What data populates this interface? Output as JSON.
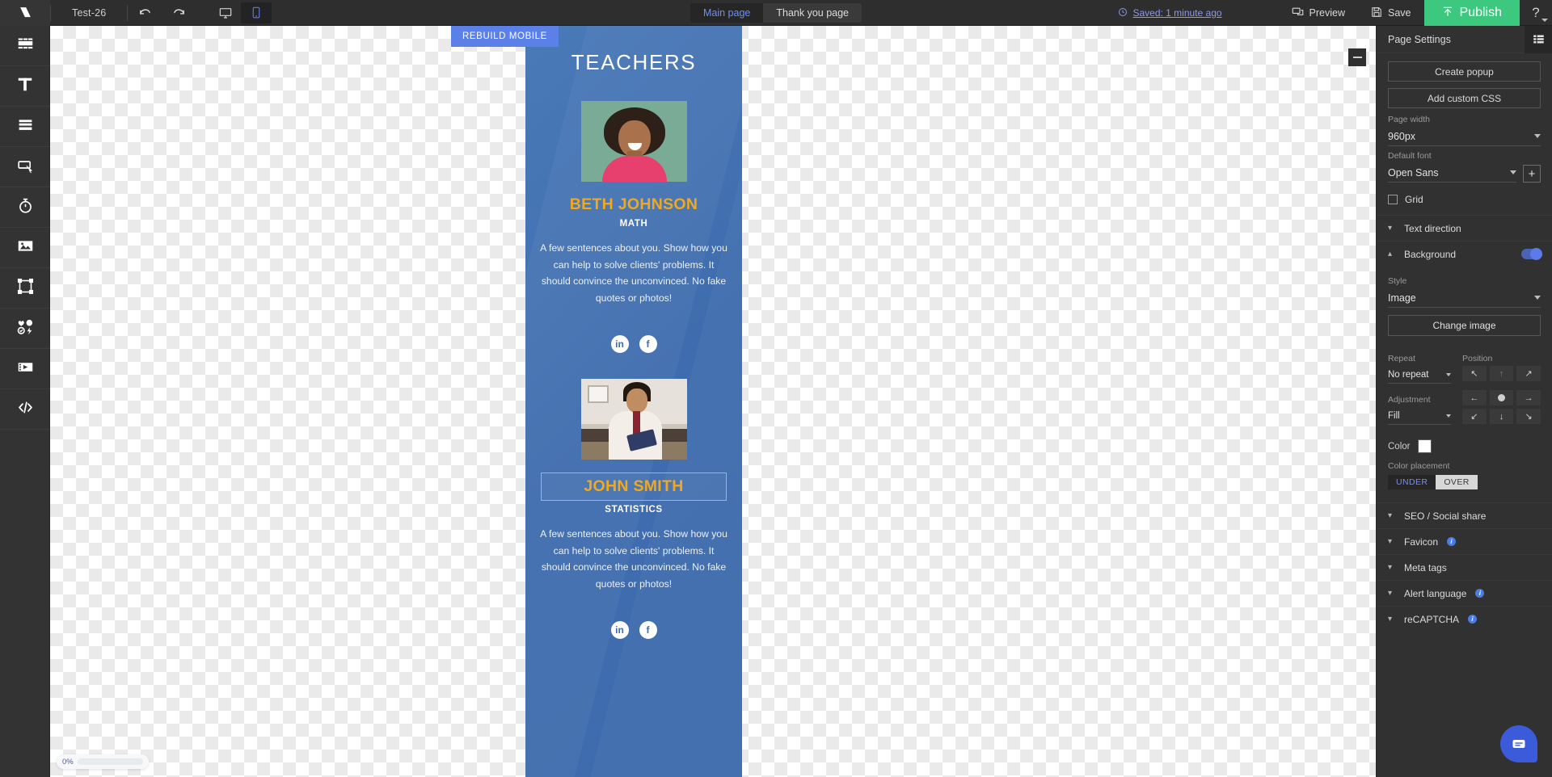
{
  "topbar": {
    "logo_icon": "brand-logo-icon",
    "project_name": "Test-26",
    "undo_icon": "undo-icon",
    "redo_icon": "redo-icon",
    "desktop_icon": "desktop-view-icon",
    "mobile_icon": "mobile-view-icon",
    "tabs": [
      {
        "label": "Main page",
        "active": true
      },
      {
        "label": "Thank you page",
        "active": false
      }
    ],
    "saved_status": "Saved: 1 minute ago",
    "clock_icon": "clock-icon",
    "preview_label": "Preview",
    "preview_icon": "preview-monitor-icon",
    "save_label": "Save",
    "save_icon": "floppy-disk-icon",
    "publish_label": "Publish",
    "publish_icon": "upload-arrow-icon",
    "help_label": "?"
  },
  "sidebar": {
    "items": [
      {
        "name": "blocks",
        "icon": "blocks-icon"
      },
      {
        "name": "text",
        "icon": "text-t-icon"
      },
      {
        "name": "forms",
        "icon": "form-rows-icon"
      },
      {
        "name": "button",
        "icon": "button-cursor-icon"
      },
      {
        "name": "timer",
        "icon": "timer-icon"
      },
      {
        "name": "image",
        "icon": "image-icon"
      },
      {
        "name": "shape",
        "icon": "shape-frame-icon"
      },
      {
        "name": "icons",
        "icon": "icons-collection-icon"
      },
      {
        "name": "video",
        "icon": "video-film-icon"
      },
      {
        "name": "code",
        "icon": "code-brackets-icon"
      }
    ]
  },
  "canvas": {
    "rebuild_label": "REBUILD MOBILE",
    "collapse_icon": "minus-collapse-icon",
    "progress_percent": "0%"
  },
  "mobile_page": {
    "heading": "TEACHERS",
    "teachers": [
      {
        "photo": "portrait-woman-laughing",
        "name": "BETH JOHNSON",
        "role": "MATH",
        "description": "A few sentences about you. Show how you can help to solve clients' problems. It should convince the unconvinced. No fake quotes or photos!",
        "selected": false,
        "social": [
          {
            "icon": "linkedin-icon",
            "glyph": "in"
          },
          {
            "icon": "facebook-icon",
            "glyph": "f"
          }
        ]
      },
      {
        "photo": "portrait-man-tablet",
        "name": "JOHN SMITH",
        "role": "STATISTICS",
        "description": "A few sentences about you. Show how you can help to solve clients' problems. It should convince the unconvinced. No fake quotes or photos!",
        "selected": true,
        "social": [
          {
            "icon": "linkedin-icon",
            "glyph": "in"
          },
          {
            "icon": "facebook-icon",
            "glyph": "f"
          }
        ]
      }
    ]
  },
  "right_panel": {
    "title": "Page Settings",
    "list_icon": "list-layers-icon",
    "create_popup_label": "Create popup",
    "add_custom_css_label": "Add custom CSS",
    "page_width_label": "Page width",
    "page_width_value": "960px",
    "default_font_label": "Default font",
    "default_font_value": "Open Sans",
    "add_font_label": "+",
    "grid_label": "Grid",
    "grid_checked": false,
    "text_direction_label": "Text direction",
    "background_label": "Background",
    "background_enabled": true,
    "style_label": "Style",
    "style_value": "Image",
    "change_image_label": "Change image",
    "repeat_label": "Repeat",
    "repeat_value": "No repeat",
    "position_label": "Position",
    "position_buttons": [
      {
        "icon": "arrow-up-left-icon",
        "glyph": "↖",
        "active": false
      },
      {
        "icon": "arrow-up-icon",
        "glyph": "↑",
        "active": true
      },
      {
        "icon": "arrow-up-right-icon",
        "glyph": "↗",
        "active": false
      },
      {
        "icon": "arrow-left-icon",
        "glyph": "←",
        "active": false
      },
      {
        "icon": "center-dot-icon",
        "glyph": "",
        "active": false
      },
      {
        "icon": "arrow-right-icon",
        "glyph": "→",
        "active": false
      },
      {
        "icon": "arrow-down-left-icon",
        "glyph": "↙",
        "active": false
      },
      {
        "icon": "arrow-down-icon",
        "glyph": "↓",
        "active": false
      },
      {
        "icon": "arrow-down-right-icon",
        "glyph": "↘",
        "active": false
      }
    ],
    "adjustment_label": "Adjustment",
    "adjustment_value": "Fill",
    "color_label": "Color",
    "color_value": "#ffffff",
    "color_placement_label": "Color placement",
    "placement_under": "UNDER",
    "placement_over": "OVER",
    "placement_selected": "UNDER",
    "accordions": [
      {
        "label": "SEO / Social share",
        "info": false
      },
      {
        "label": "Favicon",
        "info": true
      },
      {
        "label": "Meta tags",
        "info": false
      },
      {
        "label": "Alert language",
        "info": true
      },
      {
        "label": "reCAPTCHA",
        "info": true
      }
    ],
    "chat_icon": "chat-bubble-icon"
  },
  "colors": {
    "publish_green": "#3cc97f",
    "accent_blue": "#5b7ce8",
    "rebuild_blue": "#5b81e8",
    "name_gold": "#f0a91f",
    "page_blue": "#3f6cae"
  }
}
